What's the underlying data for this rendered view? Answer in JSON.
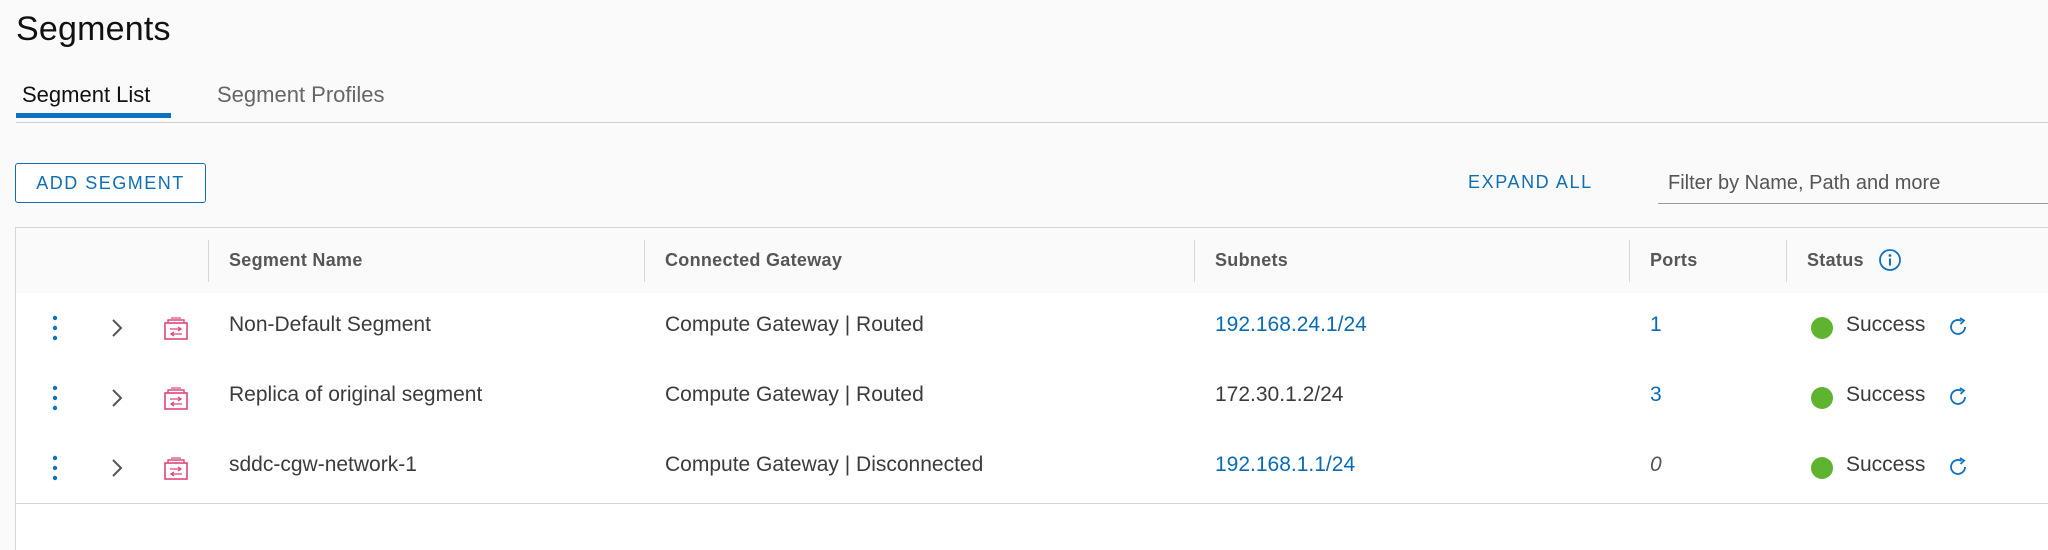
{
  "page": {
    "title": "Segments"
  },
  "tabs": [
    {
      "label": "Segment List",
      "active": true
    },
    {
      "label": "Segment Profiles",
      "active": false
    }
  ],
  "toolbar": {
    "add_label": "ADD SEGMENT",
    "expand_label": "EXPAND ALL",
    "filter_placeholder": "Filter by Name, Path and more"
  },
  "table": {
    "headers": {
      "name": "Segment Name",
      "gateway": "Connected Gateway",
      "subnets": "Subnets",
      "ports": "Ports",
      "status": "Status"
    },
    "rows": [
      {
        "name": "Non-Default Segment",
        "gateway": "Compute Gateway | Routed",
        "subnet": "192.168.24.1/24",
        "subnet_link": true,
        "ports": "1",
        "ports_style": "link",
        "status": "Success"
      },
      {
        "name": "Replica of original segment",
        "gateway": "Compute Gateway | Routed",
        "subnet": "172.30.1.2/24",
        "subnet_link": false,
        "ports": "3",
        "ports_style": "link",
        "status": "Success"
      },
      {
        "name": "sddc-cgw-network-1",
        "gateway": "Compute Gateway | Disconnected",
        "subnet": "192.168.1.1/24",
        "subnet_link": true,
        "ports": "0",
        "ports_style": "italic",
        "status": "Success"
      }
    ]
  },
  "colors": {
    "accent": "#0f72c0",
    "link": "#0a6bb5",
    "status_success": "#5eb32f",
    "segment_icon": "#e0457b"
  },
  "icons": {
    "row_actions": "kebab-icon",
    "expand": "chevron-right-icon",
    "segment": "segment-icon",
    "status_info": "info-icon",
    "refresh": "refresh-icon"
  }
}
